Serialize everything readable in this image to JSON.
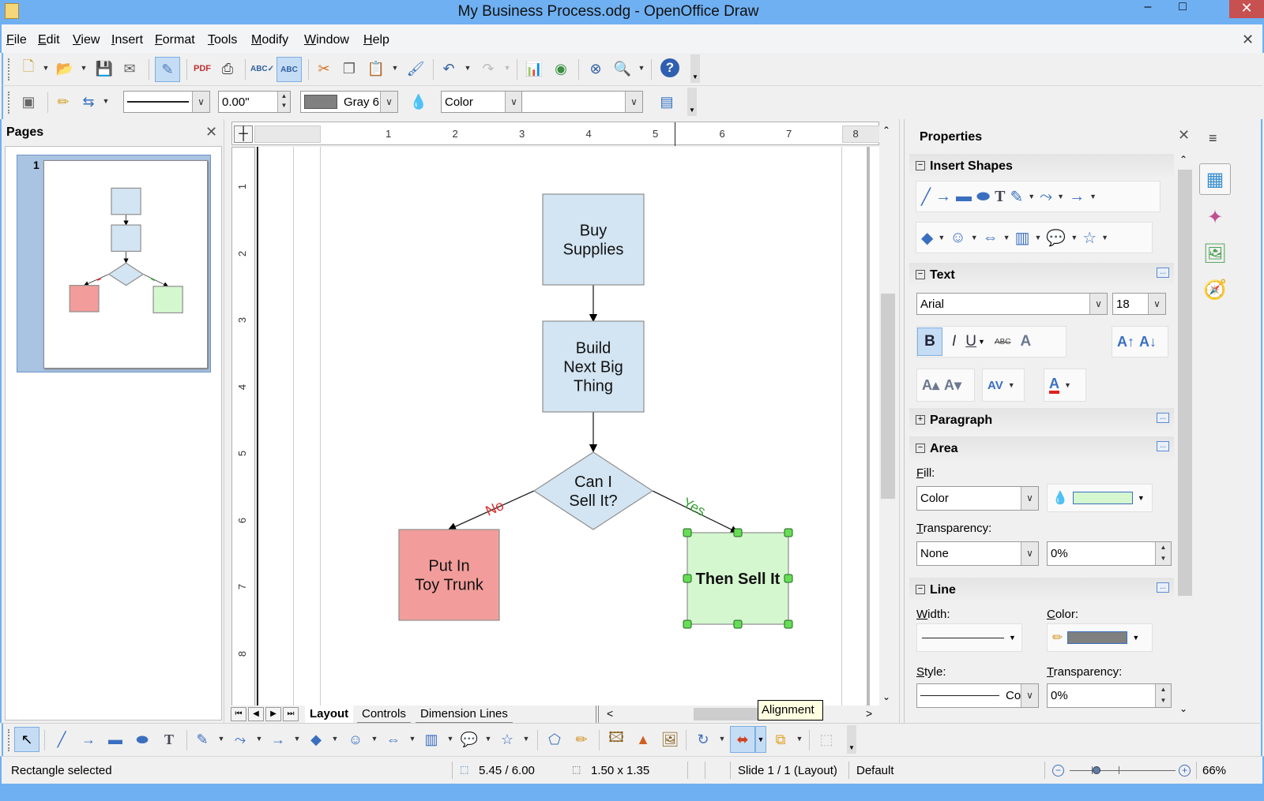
{
  "window": {
    "title": "My Business Process.odg - OpenOffice Draw",
    "minimize_glyph": "–",
    "maximize_glyph": "□",
    "close_glyph": "✕",
    "doc_close_glyph": "✕"
  },
  "menu": [
    "File",
    "Edit",
    "View",
    "Insert",
    "Format",
    "Tools",
    "Modify",
    "Window",
    "Help"
  ],
  "standard_toolbar": {
    "icons": [
      "new-icon",
      "open-icon",
      "save-icon",
      "email-icon",
      "edit-file-icon",
      "export-pdf-icon",
      "print-icon",
      "spellcheck-icon",
      "autospellcheck-icon",
      "cut-icon",
      "copy-icon",
      "paste-icon",
      "clone-formatting-icon",
      "undo-icon",
      "redo-icon",
      "chart-icon",
      "fontwork-icon",
      "navigator-icon",
      "zoom-icon",
      "help-icon"
    ]
  },
  "line_fill_toolbar": {
    "line_width_value": "0.00\"",
    "line_color_name": "Gray 6",
    "line_color_hex": "#808080",
    "area_style": "Color",
    "area_value": ""
  },
  "pages_panel": {
    "title": "Pages",
    "close_glyph": "✕",
    "pages": [
      {
        "number": "1"
      }
    ]
  },
  "ruler": {
    "h_labels": [
      "1",
      "2",
      "3",
      "4",
      "5",
      "6",
      "7",
      "8"
    ],
    "v_labels": [
      "1",
      "2",
      "3",
      "4",
      "5",
      "6",
      "7",
      "8"
    ]
  },
  "diagram": {
    "shapes": [
      {
        "id": "buy",
        "type": "rect",
        "lines": [
          "Buy",
          "Supplies"
        ],
        "fill": "#d3e4f2"
      },
      {
        "id": "build",
        "type": "rect",
        "lines": [
          "Build",
          "Next Big",
          "Thing"
        ],
        "fill": "#d3e4f2"
      },
      {
        "id": "decision",
        "type": "diamond",
        "lines": [
          "Can I",
          "Sell It?"
        ],
        "fill": "#d3e4f2"
      },
      {
        "id": "trunk",
        "type": "rect",
        "lines": [
          "Put In",
          "Toy Trunk"
        ],
        "fill": "#f29d9b"
      },
      {
        "id": "sell",
        "type": "rect",
        "lines": [
          "Then Sell It"
        ],
        "fill": "#d4f7cf",
        "selected": true
      }
    ],
    "connector_labels": {
      "no": {
        "text": "No",
        "color": "#e03030"
      },
      "yes": {
        "text": "Yes",
        "color": "#3aa03a"
      }
    }
  },
  "sheet_tabs": [
    "Layout",
    "Controls",
    "Dimension Lines"
  ],
  "active_tab": "Layout",
  "tooltip": "Alignment",
  "properties": {
    "title": "Properties",
    "close_glyph": "✕",
    "sections": {
      "insert_shapes": "Insert Shapes",
      "text": "Text",
      "paragraph": "Paragraph",
      "area": "Area",
      "line": "Line"
    },
    "text": {
      "font": "Arial",
      "size": "18"
    },
    "area": {
      "fill_label": "Fill:",
      "fill_type": "Color",
      "fill_color": "#d4f7cf",
      "transparency_label": "Transparency:",
      "transparency_type": "None",
      "transparency_value": "0%"
    },
    "line": {
      "width_label": "Width:",
      "color_label": "Color:",
      "color_hex": "#808080",
      "style_label": "Style:",
      "style_value": "Co",
      "transparency_label": "Transparency:",
      "transparency_value": "0%"
    }
  },
  "deck": {
    "menu_glyph": "≡"
  },
  "status": {
    "selection": "Rectangle selected",
    "position": "5.45 / 6.00",
    "size": "1.50 x 1.35",
    "slide": "Slide 1 / 1 (Layout)",
    "master": "Default",
    "zoom_percent": "66%",
    "zoom_slider_fraction": 0.25
  }
}
